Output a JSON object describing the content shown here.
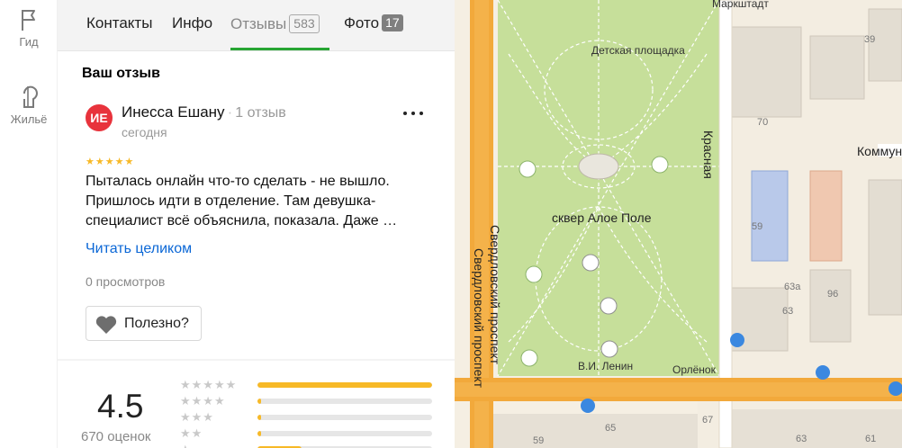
{
  "rail": {
    "items": [
      {
        "label": "Гид",
        "icon": "flag-icon"
      },
      {
        "label": "Жильё",
        "icon": "house-balloon-icon"
      }
    ]
  },
  "tabs": [
    {
      "label": "Контакты"
    },
    {
      "label": "Инфо"
    },
    {
      "label": "Отзывы",
      "count": "583",
      "active": true
    },
    {
      "label": "Фото",
      "count": "17"
    }
  ],
  "review": {
    "section_title": "Ваш отзыв",
    "avatar_initials": "ИЕ",
    "author": "Инесса Ешану",
    "author_reviews": "1 отзыв",
    "date": "сегодня",
    "stars": "★★★★★",
    "text": "Пыталась онлайн что-то сделать - не вышло. Пришлось идти в отделение. Там девушка-специалист всё объяснила, показала. Даже …",
    "read_more": "Читать целиком",
    "views": "0 просмотров",
    "useful_label": "Полезно?"
  },
  "rating": {
    "value": "4.5",
    "count": "670 оценок",
    "distribution": [
      {
        "stars": "★★★★★",
        "fraction": 1.0
      },
      {
        "stars": "★★★★",
        "fraction": 0.02
      },
      {
        "stars": "★★★",
        "fraction": 0.02
      },
      {
        "stars": "★★",
        "fraction": 0.02
      },
      {
        "stars": "★",
        "fraction": 0.25
      }
    ]
  },
  "map": {
    "labels": {
      "park": "сквер Алое Поле",
      "playground": "Детская площадка",
      "monument": "В.И. Ленин",
      "orlenok": "Орлёнок",
      "markshtadt": "Маркштадт",
      "kommun": "Коммун",
      "krasnaya": "Красная",
      "prospekt": "Свердловский проспект"
    },
    "house_numbers": [
      "39",
      "70",
      "59",
      "63а",
      "96",
      "63",
      "67",
      "65",
      "63",
      "61",
      "59"
    ]
  }
}
